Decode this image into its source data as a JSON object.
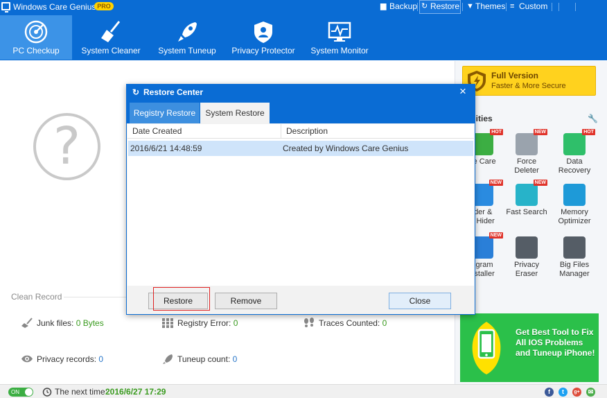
{
  "titlebar": {
    "app_title": "Windows Care Genius",
    "badge": "PRO",
    "links": [
      "Backup",
      "Restore",
      "Themes",
      "Custom"
    ],
    "active_link": "Restore"
  },
  "nav": {
    "items": [
      "PC Checkup",
      "System Cleaner",
      "System Tuneup",
      "Privacy Protector",
      "System Monitor"
    ],
    "active": "PC Checkup"
  },
  "main": {
    "placeholder_glyph": "?",
    "clean_record_title": "Clean Record",
    "stats": {
      "junk_label": "Junk files:",
      "junk_value": "0 Bytes",
      "registry_label": "Registry Error:",
      "registry_value": "0",
      "traces_label": "Traces Counted:",
      "traces_value": "0",
      "privacy_label": "Privacy records:",
      "privacy_value": "0",
      "tuneup_label": "Tuneup count:",
      "tuneup_value": "0"
    }
  },
  "right_panel": {
    "full_version_title": "Full Version",
    "full_version_sub": "Faster & More Secure",
    "utilities_title": "ilities",
    "tools": [
      {
        "line1": "ne Care",
        "line2": "",
        "badge": "HOT",
        "color": "#3cae43",
        "icon": "phone-care-icon"
      },
      {
        "line1": "Force",
        "line2": "Deleter",
        "badge": "NEW",
        "color": "#9aa3ad",
        "icon": "trash-lightning-icon"
      },
      {
        "line1": "Data",
        "line2": "Recovery",
        "badge": "HOT",
        "color": "#2fbf6a",
        "icon": "data-recovery-icon"
      },
      {
        "line1": "lder &",
        "line2": "e Hider",
        "badge": "NEW",
        "color": "#2a8be0",
        "icon": "folder-hider-icon"
      },
      {
        "line1": "Fast Search",
        "line2": "",
        "badge": "NEW",
        "color": "#27b3c9",
        "icon": "magnifier-icon"
      },
      {
        "line1": "Memory",
        "line2": "Optimizer",
        "badge": "",
        "color": "#1e9ad8",
        "icon": "memory-chip-icon"
      },
      {
        "line1": "ogram",
        "line2": "nstaller",
        "badge": "NEW",
        "color": "#2a7fd8",
        "icon": "uninstaller-icon"
      },
      {
        "line1": "Privacy",
        "line2": "Eraser",
        "badge": "",
        "color": "#555d66",
        "icon": "eye-slash-icon"
      },
      {
        "line1": "Big Files",
        "line2": "Manager",
        "badge": "",
        "color": "#555d66",
        "icon": "folder-icon"
      }
    ],
    "ios_banner": "Get Best Tool to Fix All IOS Problems and Tuneup iPhone!"
  },
  "statusbar": {
    "toggle": "ON",
    "next_label": "The next time:",
    "next_time": "2016/6/27 17:29",
    "social": [
      "f",
      "t",
      "g+",
      "✉"
    ]
  },
  "dialog": {
    "title": "Restore Center",
    "close": "×",
    "tabs": [
      "Registry Restore",
      "System Restore"
    ],
    "active_tab": "System Restore",
    "columns": [
      "Date Created",
      "Description"
    ],
    "rows": [
      {
        "date": "2016/6/21 14:48:59",
        "description": "Created by Windows Care Genius"
      }
    ],
    "buttons": {
      "restore": "Restore",
      "remove": "Remove",
      "close": "Close"
    }
  }
}
